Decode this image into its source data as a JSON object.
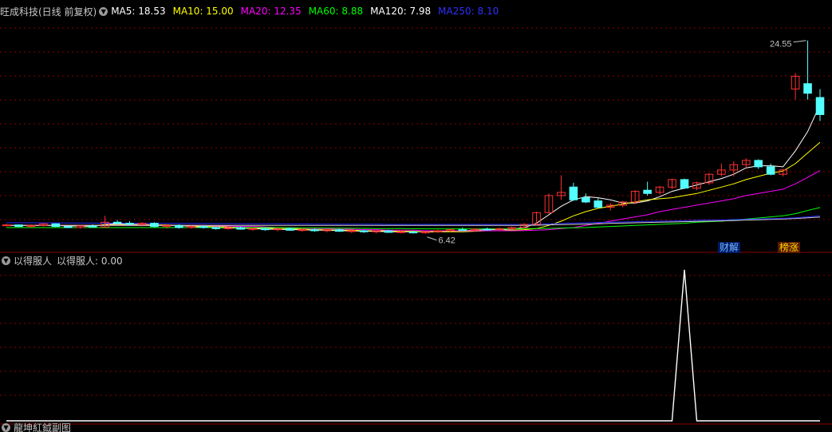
{
  "main_legend": {
    "title": "旺成科技(日线 前复权)",
    "indicators": [
      {
        "label": "MA5: 18.53",
        "color": "#ffffff"
      },
      {
        "label": "MA10: 15.00",
        "color": "#ffff00"
      },
      {
        "label": "MA20: 12.35",
        "color": "#ff00ff"
      },
      {
        "label": "MA60: 8.88",
        "color": "#00ff00"
      },
      {
        "label": "MA120: 7.98",
        "color": "#ffffff"
      },
      {
        "label": "MA250: 8.10",
        "color": "#0000ff"
      }
    ]
  },
  "sub_legend": {
    "name": "以得服人",
    "value_label": "以得服人: 0.00"
  },
  "bottom_legend": {
    "text": "龍坤紅鉞副图"
  },
  "badges": {
    "caijie": "财解",
    "bangzhang": "榜涨"
  },
  "colors": {
    "up": "#ff3232",
    "down": "#54ffff",
    "grid": "#8a0000",
    "separator": "#8a0000"
  },
  "chart_data": [
    {
      "type": "candlestick",
      "y_range": [
        5.5,
        27.0
      ],
      "annotations": [
        {
          "label": "24.55",
          "value": 24.55,
          "kind": "high"
        },
        {
          "label": "6.42",
          "value": 6.42,
          "kind": "low"
        }
      ],
      "candles": [
        [
          7.2,
          7.35,
          7.1,
          7.25
        ],
        [
          7.25,
          7.3,
          7.05,
          7.1
        ],
        [
          7.1,
          7.3,
          7.0,
          7.2
        ],
        [
          7.2,
          7.4,
          7.1,
          7.35
        ],
        [
          7.35,
          7.4,
          7.05,
          7.1
        ],
        [
          7.1,
          7.2,
          6.95,
          7.0
        ],
        [
          7.0,
          7.2,
          6.9,
          7.15
        ],
        [
          7.15,
          7.3,
          7.0,
          7.05
        ],
        [
          7.05,
          8.1,
          7.0,
          7.5
        ],
        [
          7.5,
          7.7,
          7.3,
          7.4
        ],
        [
          7.4,
          7.6,
          7.2,
          7.3
        ],
        [
          7.3,
          7.5,
          7.1,
          7.4
        ],
        [
          7.4,
          7.5,
          7.0,
          7.1
        ],
        [
          7.1,
          7.3,
          6.9,
          7.2
        ],
        [
          7.2,
          7.3,
          6.9,
          7.0
        ],
        [
          7.0,
          7.2,
          6.9,
          7.1
        ],
        [
          7.1,
          7.2,
          6.9,
          7.0
        ],
        [
          7.0,
          7.1,
          6.8,
          6.9
        ],
        [
          6.9,
          7.1,
          6.8,
          7.0
        ],
        [
          7.0,
          7.1,
          6.8,
          6.85
        ],
        [
          6.85,
          7.0,
          6.7,
          6.9
        ],
        [
          6.9,
          7.0,
          6.7,
          6.8
        ],
        [
          6.8,
          6.95,
          6.65,
          6.9
        ],
        [
          6.9,
          7.0,
          6.7,
          6.75
        ],
        [
          6.75,
          6.9,
          6.6,
          6.8
        ],
        [
          6.8,
          6.9,
          6.6,
          6.7
        ],
        [
          6.7,
          6.85,
          6.55,
          6.8
        ],
        [
          6.8,
          6.9,
          6.6,
          6.65
        ],
        [
          6.65,
          6.8,
          6.5,
          6.7
        ],
        [
          6.7,
          6.8,
          6.5,
          6.6
        ],
        [
          6.6,
          6.75,
          6.45,
          6.7
        ],
        [
          6.7,
          6.8,
          6.5,
          6.55
        ],
        [
          6.55,
          6.7,
          6.45,
          6.6
        ],
        [
          6.6,
          6.7,
          6.45,
          6.5
        ],
        [
          6.5,
          6.65,
          6.42,
          6.6
        ],
        [
          6.6,
          6.8,
          6.5,
          6.7
        ],
        [
          6.7,
          6.9,
          6.6,
          6.8
        ],
        [
          6.8,
          7.0,
          6.7,
          6.75
        ],
        [
          6.75,
          6.9,
          6.6,
          6.85
        ],
        [
          6.85,
          7.0,
          6.7,
          6.8
        ],
        [
          6.8,
          7.0,
          6.7,
          6.9
        ],
        [
          6.9,
          7.1,
          6.8,
          7.0
        ],
        [
          7.0,
          7.4,
          6.9,
          7.3
        ],
        [
          7.3,
          8.5,
          7.2,
          8.4
        ],
        [
          8.4,
          10.2,
          8.3,
          10.0
        ],
        [
          10.0,
          11.9,
          9.6,
          10.3
        ],
        [
          10.8,
          11.2,
          9.5,
          9.6
        ],
        [
          9.8,
          10.2,
          9.3,
          9.4
        ],
        [
          9.5,
          9.8,
          8.8,
          8.9
        ],
        [
          8.9,
          9.3,
          8.6,
          9.1
        ],
        [
          9.1,
          9.5,
          8.9,
          9.4
        ],
        [
          9.4,
          10.5,
          9.2,
          10.4
        ],
        [
          10.5,
          11.3,
          10.0,
          10.2
        ],
        [
          10.3,
          10.9,
          10.1,
          10.8
        ],
        [
          10.8,
          11.6,
          10.6,
          11.5
        ],
        [
          11.5,
          11.6,
          10.6,
          10.7
        ],
        [
          10.7,
          11.3,
          10.5,
          11.2
        ],
        [
          11.2,
          12.1,
          11.0,
          12.0
        ],
        [
          12.0,
          13.0,
          11.8,
          12.4
        ],
        [
          12.4,
          13.2,
          11.8,
          12.9
        ],
        [
          12.9,
          13.5,
          12.5,
          13.3
        ],
        [
          13.3,
          13.4,
          12.5,
          12.7
        ],
        [
          12.7,
          13.0,
          11.9,
          12.0
        ],
        [
          12.0,
          12.5,
          11.8,
          12.4
        ],
        [
          20.0,
          21.5,
          19.0,
          21.2
        ],
        [
          20.5,
          24.55,
          19.0,
          19.6
        ],
        [
          19.2,
          20.0,
          17.0,
          17.6
        ]
      ],
      "ma": {
        "MA5": [
          7.2,
          7.2,
          7.2,
          7.2,
          7.2,
          7.15,
          7.15,
          7.1,
          7.3,
          7.35,
          7.3,
          7.3,
          7.25,
          7.2,
          7.2,
          7.1,
          7.05,
          7.0,
          6.95,
          6.95,
          6.9,
          6.85,
          6.85,
          6.8,
          6.8,
          6.75,
          6.75,
          6.7,
          6.7,
          6.65,
          6.65,
          6.6,
          6.6,
          6.6,
          6.6,
          6.6,
          6.65,
          6.7,
          6.75,
          6.8,
          6.8,
          6.85,
          7.0,
          7.4,
          8.2,
          9.0,
          9.6,
          9.9,
          9.8,
          9.6,
          9.3,
          9.3,
          9.5,
          9.9,
          10.4,
          10.7,
          11.0,
          11.3,
          11.6,
          12.0,
          12.6,
          12.8,
          12.8,
          12.7,
          14.2,
          16.0,
          18.53
        ],
        "MA10": [
          7.2,
          7.2,
          7.2,
          7.2,
          7.2,
          7.2,
          7.2,
          7.2,
          7.25,
          7.25,
          7.25,
          7.25,
          7.25,
          7.25,
          7.2,
          7.15,
          7.1,
          7.1,
          7.05,
          7.0,
          6.95,
          6.95,
          6.9,
          6.9,
          6.85,
          6.8,
          6.8,
          6.75,
          6.75,
          6.7,
          6.7,
          6.7,
          6.65,
          6.65,
          6.6,
          6.6,
          6.6,
          6.6,
          6.65,
          6.7,
          6.7,
          6.75,
          6.8,
          6.9,
          7.2,
          7.6,
          8.1,
          8.5,
          8.8,
          9.0,
          9.2,
          9.4,
          9.6,
          9.7,
          9.8,
          10.0,
          10.2,
          10.5,
          10.8,
          11.1,
          11.5,
          11.8,
          12.1,
          12.3,
          13.0,
          14.0,
          15.0
        ],
        "MA20": [
          7.2,
          7.2,
          7.2,
          7.2,
          7.2,
          7.2,
          7.2,
          7.2,
          7.2,
          7.2,
          7.2,
          7.2,
          7.2,
          7.2,
          7.2,
          7.2,
          7.2,
          7.15,
          7.15,
          7.1,
          7.1,
          7.05,
          7.0,
          7.0,
          6.95,
          6.9,
          6.9,
          6.85,
          6.85,
          6.8,
          6.8,
          6.75,
          6.75,
          6.75,
          6.7,
          6.7,
          6.7,
          6.7,
          6.7,
          6.7,
          6.7,
          6.7,
          6.72,
          6.75,
          6.8,
          6.9,
          7.0,
          7.2,
          7.4,
          7.6,
          7.8,
          8.0,
          8.2,
          8.5,
          8.7,
          8.9,
          9.1,
          9.3,
          9.5,
          9.7,
          10.0,
          10.2,
          10.4,
          10.6,
          11.1,
          11.7,
          12.35
        ],
        "MA60": [
          7.0,
          7.0,
          7.0,
          7.0,
          7.0,
          7.0,
          7.0,
          7.0,
          7.0,
          7.0,
          7.0,
          7.0,
          7.0,
          7.0,
          7.0,
          7.0,
          7.0,
          7.0,
          7.0,
          7.0,
          7.0,
          7.0,
          7.0,
          6.98,
          6.97,
          6.96,
          6.95,
          6.94,
          6.93,
          6.92,
          6.91,
          6.9,
          6.9,
          6.89,
          6.88,
          6.88,
          6.88,
          6.88,
          6.88,
          6.88,
          6.88,
          6.88,
          6.89,
          6.9,
          6.92,
          6.95,
          6.98,
          7.0,
          7.05,
          7.1,
          7.15,
          7.2,
          7.25,
          7.3,
          7.35,
          7.4,
          7.5,
          7.55,
          7.6,
          7.7,
          7.8,
          7.9,
          8.0,
          8.1,
          8.3,
          8.6,
          8.88
        ],
        "MA120": [
          7.2,
          7.2,
          7.2,
          7.2,
          7.2,
          7.2,
          7.2,
          7.2,
          7.2,
          7.2,
          7.2,
          7.2,
          7.2,
          7.2,
          7.2,
          7.2,
          7.2,
          7.2,
          7.2,
          7.2,
          7.2,
          7.2,
          7.2,
          7.2,
          7.2,
          7.2,
          7.2,
          7.2,
          7.2,
          7.2,
          7.2,
          7.2,
          7.2,
          7.2,
          7.2,
          7.2,
          7.2,
          7.2,
          7.2,
          7.2,
          7.2,
          7.2,
          7.2,
          7.22,
          7.25,
          7.28,
          7.3,
          7.33,
          7.36,
          7.4,
          7.42,
          7.45,
          7.48,
          7.5,
          7.52,
          7.55,
          7.58,
          7.6,
          7.63,
          7.66,
          7.7,
          7.73,
          7.76,
          7.8,
          7.85,
          7.92,
          7.98
        ],
        "MA250": [
          7.45,
          7.45,
          7.45,
          7.44,
          7.44,
          7.43,
          7.43,
          7.42,
          7.42,
          7.41,
          7.41,
          7.4,
          7.4,
          7.39,
          7.39,
          7.38,
          7.38,
          7.37,
          7.37,
          7.36,
          7.36,
          7.35,
          7.35,
          7.34,
          7.34,
          7.33,
          7.33,
          7.32,
          7.32,
          7.31,
          7.31,
          7.3,
          7.3,
          7.3,
          7.3,
          7.3,
          7.3,
          7.3,
          7.3,
          7.3,
          7.3,
          7.3,
          7.3,
          7.32,
          7.35,
          7.38,
          7.42,
          7.45,
          7.48,
          7.5,
          7.52,
          7.55,
          7.58,
          7.6,
          7.62,
          7.65,
          7.68,
          7.7,
          7.72,
          7.75,
          7.78,
          7.8,
          7.83,
          7.86,
          7.92,
          8.0,
          8.1
        ]
      }
    },
    {
      "type": "line",
      "series": [
        {
          "name": "以得服人",
          "values": [
            0,
            0,
            0,
            0,
            0,
            0,
            0,
            0,
            0,
            0,
            0,
            0,
            0,
            0,
            0,
            0,
            0,
            0,
            0,
            0,
            0,
            0,
            0,
            0,
            0,
            0,
            0,
            0,
            0,
            0,
            0,
            0,
            0,
            0,
            0,
            0,
            0,
            0,
            0,
            0,
            0,
            0,
            0,
            0,
            0,
            0,
            0,
            0,
            0,
            0,
            0,
            0,
            0,
            0,
            0,
            1,
            0,
            0,
            0,
            0,
            0,
            0,
            0,
            0,
            0,
            0,
            0
          ]
        }
      ],
      "y_range": [
        0,
        1.02
      ]
    }
  ]
}
